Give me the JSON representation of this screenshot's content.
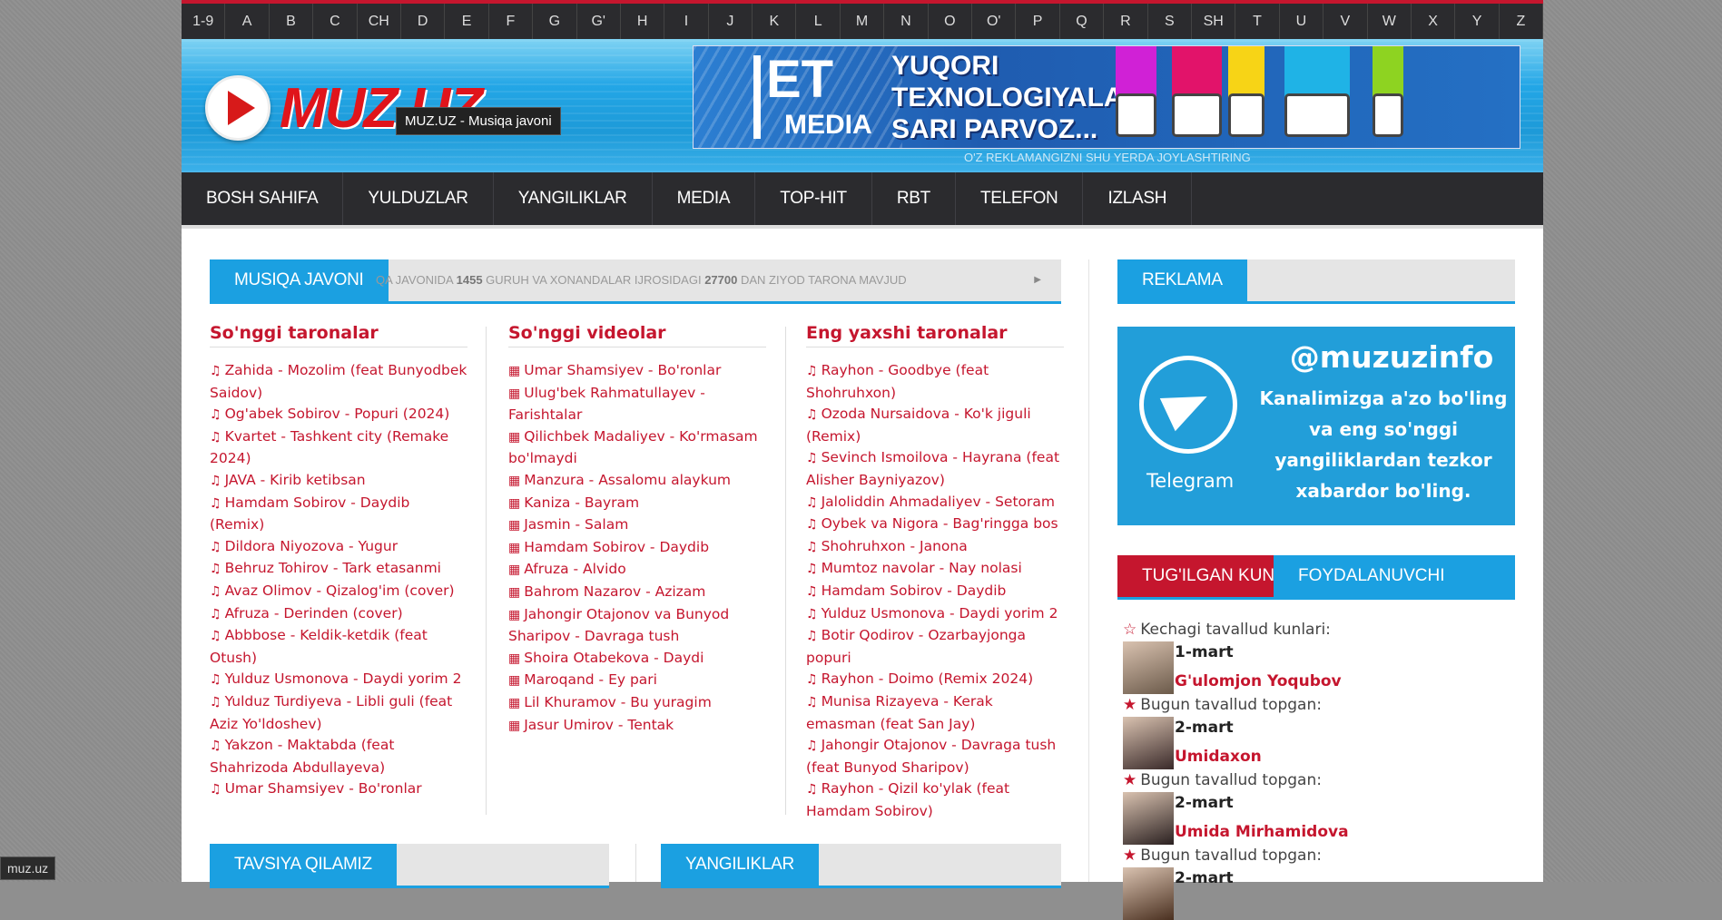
{
  "alphabet": [
    "1-9",
    "A",
    "B",
    "C",
    "CH",
    "D",
    "E",
    "F",
    "G",
    "G'",
    "H",
    "I",
    "J",
    "K",
    "L",
    "M",
    "N",
    "O",
    "O'",
    "P",
    "Q",
    "R",
    "S",
    "SH",
    "T",
    "U",
    "V",
    "W",
    "X",
    "Y",
    "Z"
  ],
  "header": {
    "logo_text": "MUZ.UZ",
    "tooltip": "MUZ.UZ - Musiqa javoni",
    "banner": {
      "brand_main": "ET",
      "brand_sub": "MEDIA",
      "slogan": [
        "YUQORI",
        "TEXNOLOGIYALAR",
        "SARI PARVOZ..."
      ],
      "device_colors": [
        "#d021d6",
        "#e2136a",
        "#f7d416",
        "#1fb3e6",
        "#8ed321"
      ]
    },
    "ad_note": "O'Z REKLAMANGIZNI SHU YERDA JOYLASHTIRING"
  },
  "nav": [
    "BOSH SAHIFA",
    "YULDUZLAR",
    "YANGILIKLAR",
    "MEDIA",
    "TOP-HIT",
    "RBT",
    "TELEFON",
    "IZLASH"
  ],
  "music_section": {
    "label": "MUSIQA JAVONI",
    "ticker_pre": "QA JAVONIDA ",
    "ticker_num1": "1455",
    "ticker_mid": " GURUH VA XONANDALAR IJROSIDAGI ",
    "ticker_num2": "27700",
    "ticker_post": " DAN ZIYOD TARONA MAVJUD"
  },
  "latest_songs": {
    "title": "So'nggi taronalar",
    "items": [
      "Zahida - Mozolim (feat Bunyodbek Saidov)",
      "Og'abek Sobirov - Popuri (2024)",
      "Kvartet - Tashkent city (Remake 2024)",
      "JAVA - Kirib ketibsan",
      "Hamdam Sobirov - Daydib (Remix)",
      "Dildora Niyozova - Yugur",
      "Behruz Tohirov - Tark etasanmi",
      "Avaz Olimov - Qizalog'im (cover)",
      "Afruza - Derinden (cover)",
      "Abbbose - Keldik-ketdik (feat Otush)",
      "Yulduz Usmonova - Daydi yorim 2",
      "Yulduz Turdiyeva - Libli guli (feat Aziz Yo'ldoshev)",
      "Yakzon - Maktabda (feat Shahrizoda Abdullayeva)",
      "Umar Shamsiyev - Bo'ronlar"
    ]
  },
  "latest_videos": {
    "title": "So'nggi videolar",
    "items": [
      "Umar Shamsiyev - Bo'ronlar",
      "Ulug'bek Rahmatullayev - Farishtalar",
      "Qilichbek Madaliyev - Ko'rmasam bo'lmaydi",
      "Manzura - Assalomu alaykum",
      "Kaniza - Bayram",
      "Jasmin - Salam",
      "Hamdam Sobirov - Daydib",
      "Afruza - Alvido",
      "Bahrom Nazarov - Azizam",
      "Jahongir Otajonov va Bunyod Sharipov - Davraga tush",
      "Shoira Otabekova - Daydi",
      "Maroqand - Ey pari",
      "Lil Khuramov - Bu yuragim",
      "Jasur Umirov - Tentak"
    ]
  },
  "best_songs": {
    "title": "Eng yaxshi taronalar",
    "items": [
      "Rayhon - Goodbye (feat Shohruhxon)",
      "Ozoda Nursaidova - Ko'k jiguli (Remix)",
      "Sevinch Ismoilova - Hayrana (feat Alisher Bayniyazov)",
      "Jaloliddin Ahmadaliyev - Setoram",
      "Oybek va Nigora - Bag'ringga bos",
      "Shohruhxon - Janona",
      "Mumtoz navolar - Nay nolasi",
      "Hamdam Sobirov - Daydib",
      "Yulduz Usmonova - Daydi yorim 2",
      "Botir Qodirov - Ozarbayjonga popuri",
      "Rayhon - Doimo (Remix 2024)",
      "Munisa Rizayeva - Kerak emasman (feat San Jay)",
      "Jahongir Otajonov - Davraga tush (feat Bunyod Sharipov)",
      "Rayhon - Qizil ko'ylak (feat Hamdam Sobirov)"
    ]
  },
  "bottom_tabs": {
    "recommend": "TAVSIYA QILAMIZ",
    "news": "YANGILIKLAR"
  },
  "sidebar": {
    "ad_label": "REKLAMA",
    "telegram": {
      "label": "Telegram",
      "handle": "@muzuzinfo",
      "message": [
        "Kanalimizga a'zo bo'ling",
        "va eng so'nggi",
        "yangiliklardan tezkor",
        "xabardor bo'ling."
      ]
    },
    "tab_birthday": "TUG'ILGAN KUN",
    "tab_user": "FOYDALANUVCHI BO'LIMI",
    "birthdays": [
      {
        "heading": "Kechagi tavallud kunlari:",
        "date": "1-mart",
        "name": "G'ulomjon Yoqubov",
        "star": "outline"
      },
      {
        "heading": "Bugun tavallud topgan:",
        "date": "2-mart",
        "name": "Umidaxon",
        "star": "filled"
      },
      {
        "heading": "Bugun tavallud topgan:",
        "date": "2-mart",
        "name": "Umida Mirhamidova",
        "star": "filled"
      },
      {
        "heading": "Bugun tavallud topgan:",
        "date": "2-mart",
        "name": "",
        "star": "filled"
      }
    ]
  },
  "status_bar": "muz.uz",
  "colors": {
    "accent_red": "#c5162e",
    "accent_blue": "#1ba0e1",
    "dark": "#2b2b2e"
  }
}
